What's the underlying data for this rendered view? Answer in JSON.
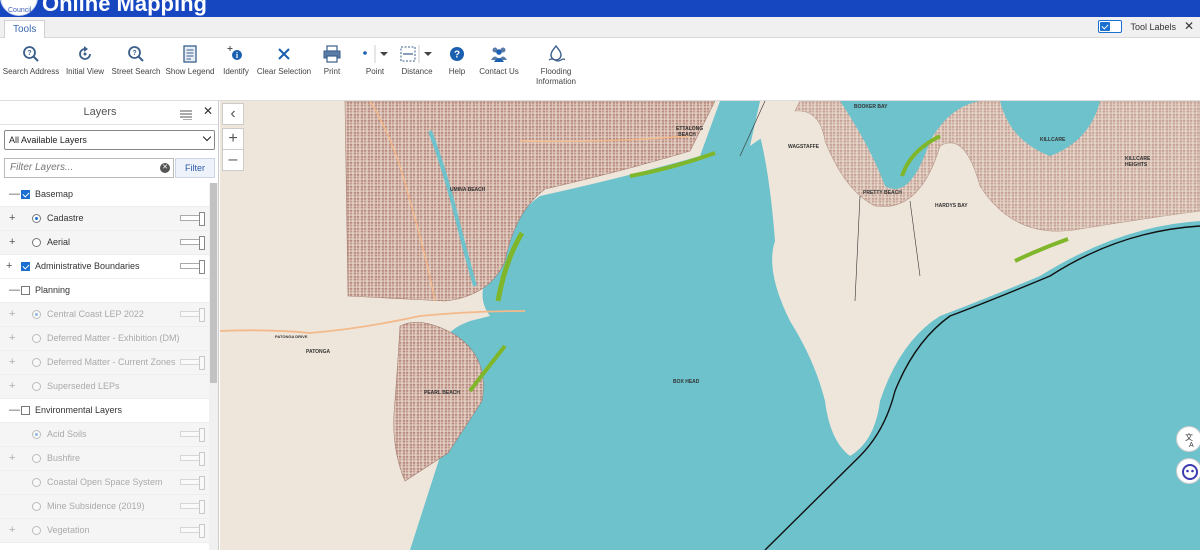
{
  "header": {
    "app_title": "Online Mapping",
    "logo_text": "Council"
  },
  "tabbar": {
    "tab_label": "Tools",
    "tool_labels_text": "Tool Labels"
  },
  "toolbar": {
    "tools": [
      {
        "label": "Search Address",
        "icon": "search-help-icon"
      },
      {
        "label": "Initial View",
        "icon": "refresh-icon"
      },
      {
        "label": "Street Search",
        "icon": "search-help-icon"
      },
      {
        "label": "Show Legend",
        "icon": "legend-icon"
      },
      {
        "label": "Identify",
        "icon": "identify-icon"
      },
      {
        "label": "Clear Selection",
        "icon": "close-icon"
      },
      {
        "label": "Print",
        "icon": "printer-icon"
      },
      {
        "label": "Point",
        "icon": "point-icon"
      },
      {
        "label": "Distance",
        "icon": "ruler-icon"
      },
      {
        "label": "Help",
        "icon": "help-icon"
      },
      {
        "label": "Contact Us",
        "icon": "people-icon"
      },
      {
        "label": "Flooding Information",
        "icon": "flood-icon"
      }
    ]
  },
  "layers_panel": {
    "title": "Layers",
    "select_value": "All Available Layers",
    "filter_placeholder": "Filter Layers...",
    "filter_button": "Filter",
    "rows": [
      {
        "name": "Basemap"
      },
      {
        "name": "Cadastre"
      },
      {
        "name": "Aerial"
      },
      {
        "name": "Administrative Boundaries"
      },
      {
        "name": "Planning"
      },
      {
        "name": "Central Coast LEP 2022"
      },
      {
        "name": "Deferred Matter - Exhibition (DM)"
      },
      {
        "name": "Deferred Matter - Current Zones"
      },
      {
        "name": "Superseded LEPs"
      },
      {
        "name": "Environmental Layers"
      },
      {
        "name": "Acid Soils"
      },
      {
        "name": "Bushfire"
      },
      {
        "name": "Coastal Open Space System"
      },
      {
        "name": "Mine Subsidence (2019)"
      },
      {
        "name": "Vegetation"
      }
    ]
  },
  "map": {
    "labels": [
      {
        "text": "BOOKER BAY"
      },
      {
        "text": "ETTALONG BEACH"
      },
      {
        "text": "WAGSTAFFE"
      },
      {
        "text": "KILLCARE"
      },
      {
        "text": "KILLCARE HEIGHTS"
      },
      {
        "text": "UMINA BEACH"
      },
      {
        "text": "PRETTY BEACH"
      },
      {
        "text": "HARDYS BAY"
      },
      {
        "text": "PATONGA DRIVE"
      },
      {
        "text": "PATONGA"
      },
      {
        "text": "BOX HEAD"
      },
      {
        "text": "PEARL BEACH"
      }
    ],
    "colors": {
      "water": "#6dc2cc",
      "land": "#efe6db",
      "suburb": "#b98a7f",
      "reserve": "#7fb62a"
    }
  }
}
